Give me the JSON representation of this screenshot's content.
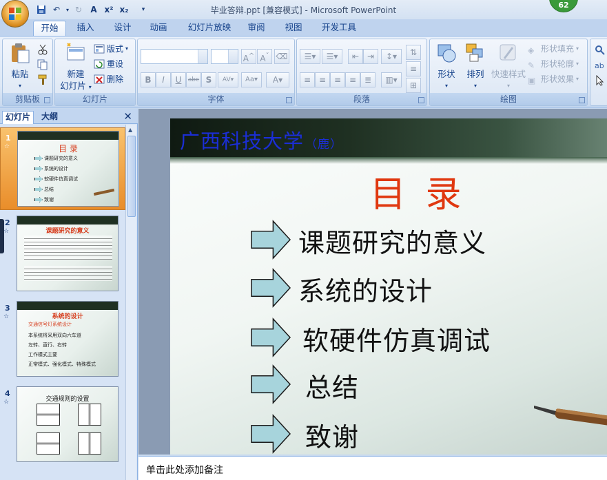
{
  "window": {
    "title": "毕业答辩.ppt [兼容模式] - Microsoft PowerPoint",
    "badge": "62"
  },
  "tabs": [
    "开始",
    "插入",
    "设计",
    "动画",
    "幻灯片放映",
    "审阅",
    "视图",
    "开发工具"
  ],
  "ribbon": {
    "clipboard": {
      "label": "剪贴板",
      "paste": "粘贴"
    },
    "slides": {
      "label": "幻灯片",
      "new_slide_line1": "新建",
      "new_slide_line2": "幻灯片",
      "layout": "版式",
      "reset": "重设",
      "delete": "删除"
    },
    "font": {
      "label": "字体"
    },
    "paragraph": {
      "label": "段落"
    },
    "drawing": {
      "label": "绘图",
      "shapes": "形状",
      "arrange": "排列",
      "quick_styles": "快速样式",
      "shape_fill": "形状填充",
      "shape_outline": "形状轮廓",
      "shape_effects": "形状效果"
    }
  },
  "left_pane": {
    "tabs": [
      "幻灯片",
      "大纲"
    ],
    "thumbnails": [
      {
        "number": "1",
        "title": "目 录",
        "items": [
          "课题研究的意义",
          "系统的设计",
          "软硬件仿真调试",
          "总结",
          "致谢"
        ]
      },
      {
        "number": "2",
        "title": "课题研究的意义"
      },
      {
        "number": "3",
        "title": "系统的设计",
        "subtitle": "交通信号灯系统设计",
        "items": [
          "本系统将采用双向六车道",
          "左转、直行、右转",
          "工作模式主要",
          "正常模式、强化模式、特殊模式"
        ]
      },
      {
        "number": "4",
        "title": "交通规则的设置"
      }
    ]
  },
  "slide": {
    "header": "广西科技大学",
    "header_sub": "（鹿）",
    "title": "目  录",
    "items": [
      "课题研究的意义",
      "系统的设计",
      "软硬件仿真调试",
      "总结",
      "致谢"
    ]
  },
  "notes": {
    "placeholder": "单击此处添加备注"
  }
}
